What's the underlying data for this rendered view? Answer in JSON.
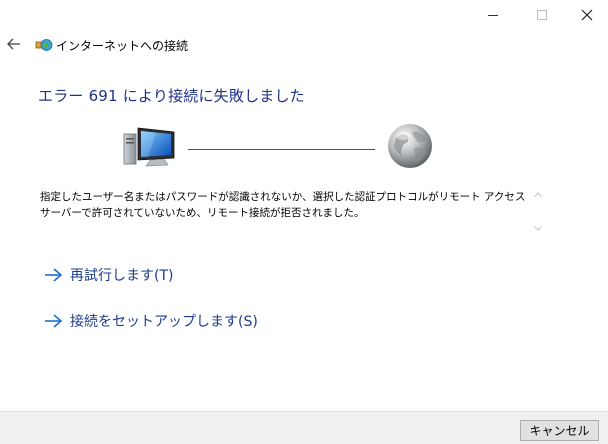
{
  "window": {
    "title": "インターネットへの接続"
  },
  "heading": "エラー 691 により接続に失敗しました",
  "message": "指定したユーザー名またはパスワードが認識されないか、選択した認証プロトコルがリモート アクセス サーバーで許可されていないため、リモート接続が拒否されました。",
  "commands": {
    "retry": "再試行します(T)",
    "setup": "接続をセットアップします(S)"
  },
  "footer": {
    "cancel_label": "キャンセル"
  },
  "icons": {
    "back": "back-arrow-icon",
    "app": "network-connection-icon",
    "computer": "computer-icon",
    "globe": "globe-icon",
    "command_arrow": "right-arrow-icon"
  },
  "colors": {
    "heading": "#1e3287",
    "command_link": "#1e3c8c",
    "footer_bg": "#f0f0f0"
  }
}
